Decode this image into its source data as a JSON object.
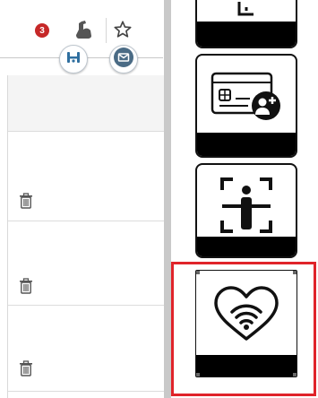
{
  "toolbar": {
    "notification_count": "3",
    "icons": [
      "muscle-icon",
      "star-icon",
      "handshake-icon",
      "mail-icon"
    ]
  },
  "table": {
    "row_icons": [
      "trash-icon",
      "trash-icon",
      "trash-icon"
    ]
  },
  "tiles": [
    {
      "icon": "window-icon"
    },
    {
      "icon": "add-card-user-icon"
    },
    {
      "icon": "face-scan-icon"
    },
    {
      "icon": "heart-wifi-icon",
      "selected": true
    }
  ],
  "colors": {
    "badge": "#c62828",
    "selection": "#e0242a",
    "tile_strip": "#000000",
    "scrollbar": "#c9c9c9"
  }
}
